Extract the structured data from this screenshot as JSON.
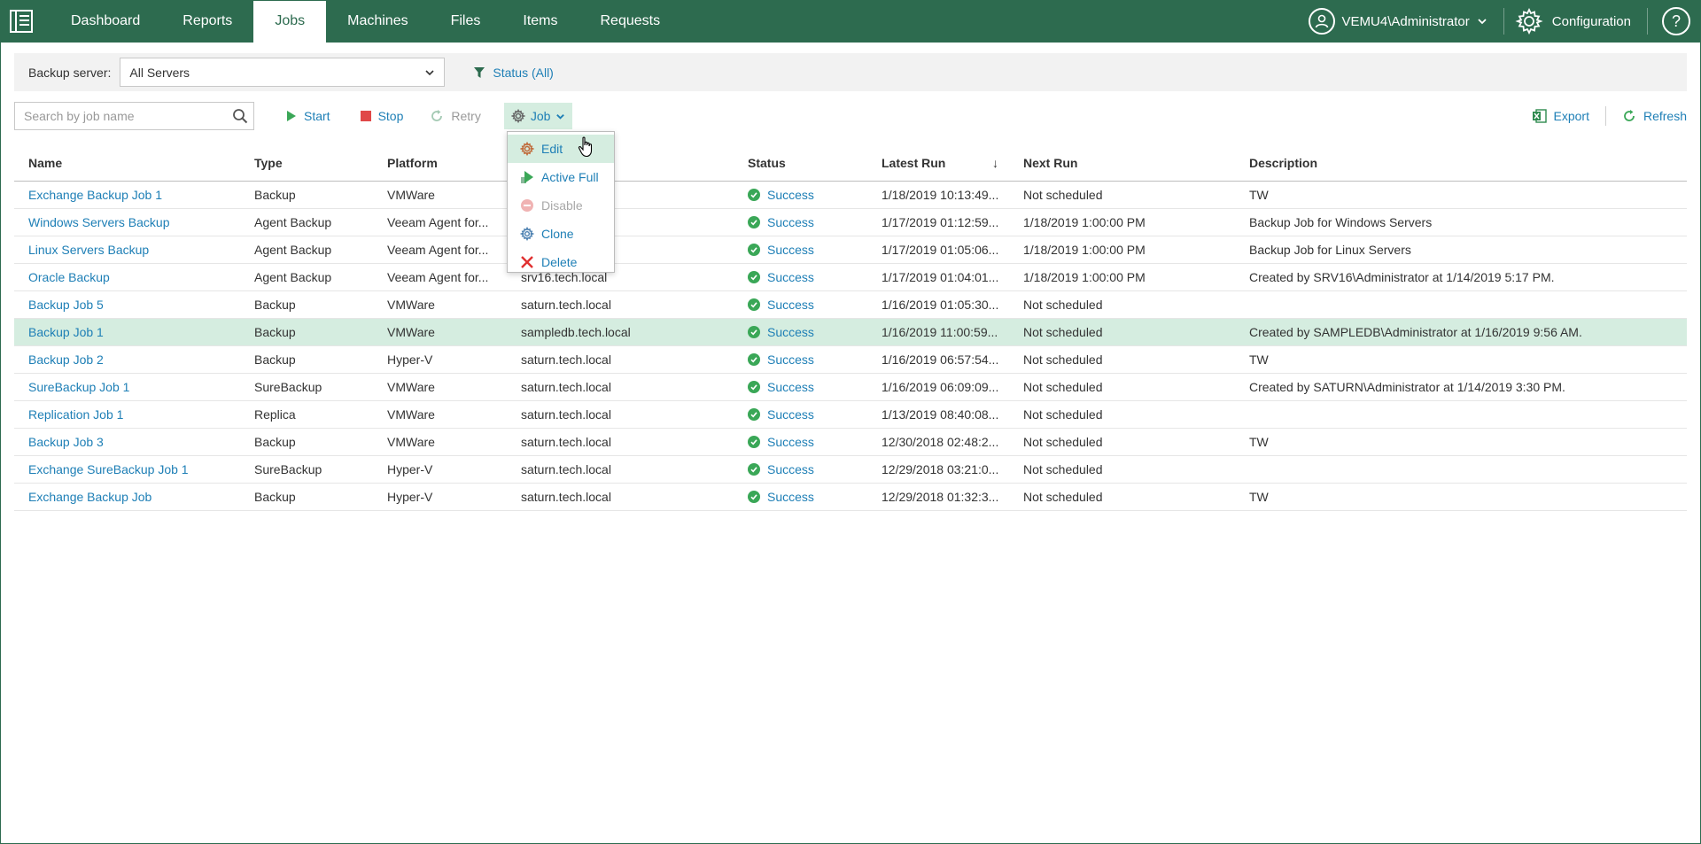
{
  "nav": {
    "tabs": [
      {
        "label": "Dashboard"
      },
      {
        "label": "Reports"
      },
      {
        "label": "Jobs"
      },
      {
        "label": "Machines"
      },
      {
        "label": "Files"
      },
      {
        "label": "Items"
      },
      {
        "label": "Requests"
      }
    ],
    "active_tab": "Jobs",
    "user": "VEMU4\\Administrator",
    "config_label": "Configuration",
    "help_label": "?"
  },
  "filter": {
    "backup_server_label": "Backup server:",
    "backup_server_value": "All Servers",
    "status_label": "Status (All)"
  },
  "toolbar": {
    "search_placeholder": "Search by job name",
    "start_label": "Start",
    "stop_label": "Stop",
    "retry_label": "Retry",
    "job_label": "Job",
    "export_label": "Export",
    "refresh_label": "Refresh"
  },
  "job_menu": {
    "items": [
      {
        "label": "Edit",
        "icon": "gear-icon",
        "state": "hover"
      },
      {
        "label": "Active Full",
        "icon": "active-full-icon",
        "state": "normal"
      },
      {
        "label": "Disable",
        "icon": "disable-icon",
        "state": "disabled"
      },
      {
        "label": "Clone",
        "icon": "clone-icon",
        "state": "normal"
      },
      {
        "label": "Delete",
        "icon": "delete-icon",
        "state": "normal"
      }
    ]
  },
  "table": {
    "columns": {
      "name": "Name",
      "type": "Type",
      "platform": "Platform",
      "server": "",
      "status": "Status",
      "latest_run": "Latest Run",
      "next_run": "Next Run",
      "description": "Description"
    },
    "sort_indicator": "↓",
    "rows": [
      {
        "name": "Exchange Backup Job 1",
        "type": "Backup",
        "platform": "VMWare",
        "server": "",
        "status": "Success",
        "latest": "1/18/2019 10:13:49...",
        "next": "Not scheduled",
        "desc": "TW"
      },
      {
        "name": "Windows Servers Backup",
        "type": "Agent Backup",
        "platform": "Veeam Agent for...",
        "server": "",
        "status": "Success",
        "latest": "1/17/2019 01:12:59...",
        "next": "1/18/2019 1:00:00 PM",
        "desc": "Backup Job for Windows Servers"
      },
      {
        "name": "Linux Servers Backup",
        "type": "Agent Backup",
        "platform": "Veeam Agent for...",
        "server": "",
        "status": "Success",
        "latest": "1/17/2019 01:05:06...",
        "next": "1/18/2019 1:00:00 PM",
        "desc": "Backup Job for Linux Servers"
      },
      {
        "name": "Oracle Backup",
        "type": "Agent Backup",
        "platform": "Veeam Agent for...",
        "server": "srv16.tech.local",
        "status": "Success",
        "latest": "1/17/2019 01:04:01...",
        "next": "1/18/2019 1:00:00 PM",
        "desc": "Created by SRV16\\Administrator at 1/14/2019 5:17 PM."
      },
      {
        "name": "Backup Job 5",
        "type": "Backup",
        "platform": "VMWare",
        "server": "saturn.tech.local",
        "status": "Success",
        "latest": "1/16/2019 01:05:30...",
        "next": "Not scheduled",
        "desc": ""
      },
      {
        "name": "Backup Job 1",
        "type": "Backup",
        "platform": "VMWare",
        "server": "sampledb.tech.local",
        "status": "Success",
        "latest": "1/16/2019 11:00:59...",
        "next": "Not scheduled",
        "desc": "Created by SAMPLEDB\\Administrator at 1/16/2019 9:56 AM.",
        "selected": true
      },
      {
        "name": "Backup Job 2",
        "type": "Backup",
        "platform": "Hyper-V",
        "server": "saturn.tech.local",
        "status": "Success",
        "latest": "1/16/2019 06:57:54...",
        "next": "Not scheduled",
        "desc": "TW"
      },
      {
        "name": "SureBackup Job 1",
        "type": "SureBackup",
        "platform": "VMWare",
        "server": "saturn.tech.local",
        "status": "Success",
        "latest": "1/16/2019 06:09:09...",
        "next": "Not scheduled",
        "desc": "Created by SATURN\\Administrator at 1/14/2019 3:30 PM."
      },
      {
        "name": "Replication Job 1",
        "type": "Replica",
        "platform": "VMWare",
        "server": "saturn.tech.local",
        "status": "Success",
        "latest": "1/13/2019 08:40:08...",
        "next": "Not scheduled",
        "desc": ""
      },
      {
        "name": "Backup Job 3",
        "type": "Backup",
        "platform": "VMWare",
        "server": "saturn.tech.local",
        "status": "Success",
        "latest": "12/30/2018 02:48:2...",
        "next": "Not scheduled",
        "desc": "TW"
      },
      {
        "name": "Exchange SureBackup Job 1",
        "type": "SureBackup",
        "platform": "Hyper-V",
        "server": "saturn.tech.local",
        "status": "Success",
        "latest": "12/29/2018 03:21:0...",
        "next": "Not scheduled",
        "desc": ""
      },
      {
        "name": "Exchange Backup Job",
        "type": "Backup",
        "platform": "Hyper-V",
        "server": "saturn.tech.local",
        "status": "Success",
        "latest": "12/29/2018 01:32:3...",
        "next": "Not scheduled",
        "desc": "TW"
      }
    ]
  },
  "colors": {
    "brand": "#2d6b4f",
    "link": "#1e7fb6",
    "selected_row": "#d5ede0",
    "success": "#3aa757",
    "stop": "#e04848",
    "delete": "#e03030"
  }
}
